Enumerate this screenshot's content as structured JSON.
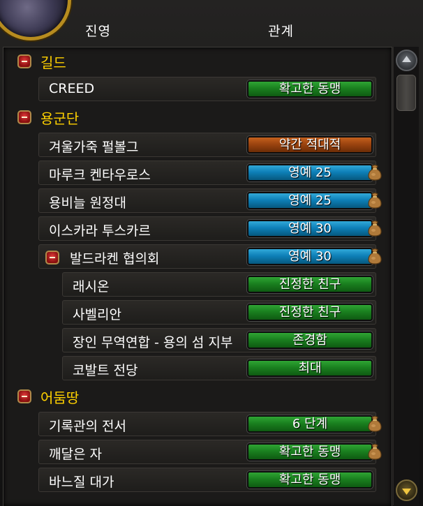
{
  "columns": {
    "faction": "진영",
    "relation": "관계"
  },
  "colors": {
    "header": "#ffd100",
    "green_bar": "#1a801f",
    "blue_bar": "#0e80b8",
    "orange_bar": "#9c4410"
  },
  "groups": [
    {
      "label": "길드",
      "rows": [
        {
          "name": "CREED",
          "standing": "확고한 동맹",
          "color": "green",
          "bag": false
        }
      ]
    },
    {
      "label": "용군단",
      "rows": [
        {
          "name": "겨울가죽 펄볼그",
          "standing": "약간 적대적",
          "color": "orange",
          "bag": false
        },
        {
          "name": "마루크 켄타우로스",
          "standing": "영예 25",
          "color": "blue",
          "bag": true
        },
        {
          "name": "용비늘 원정대",
          "standing": "영예 25",
          "color": "blue",
          "bag": true
        },
        {
          "name": "이스카라 투스카르",
          "standing": "영예 30",
          "color": "blue",
          "bag": true
        },
        {
          "name": "발드라켄 협의회",
          "standing": "영예 30",
          "color": "blue",
          "bag": true,
          "collapsible": true
        },
        {
          "name": "래시온",
          "standing": "진정한 친구",
          "color": "green",
          "bag": false,
          "indent": true
        },
        {
          "name": "사벨리안",
          "standing": "진정한 친구",
          "color": "green",
          "bag": false,
          "indent": true
        },
        {
          "name": "장인 무역연합 - 용의 섬 지부",
          "standing": "존경함",
          "color": "green",
          "bag": false,
          "indent": true
        },
        {
          "name": "코발트 전당",
          "standing": "최대",
          "color": "green",
          "bag": false,
          "indent": true
        }
      ]
    },
    {
      "label": "어둠땅",
      "rows": [
        {
          "name": "기록관의 전서",
          "standing": "6 단계",
          "color": "green",
          "bag": true
        },
        {
          "name": "깨달은 자",
          "standing": "확고한 동맹",
          "color": "green",
          "bag": true
        },
        {
          "name": "바느질 대가",
          "standing": "확고한 동맹",
          "color": "green",
          "bag": false
        }
      ]
    }
  ]
}
